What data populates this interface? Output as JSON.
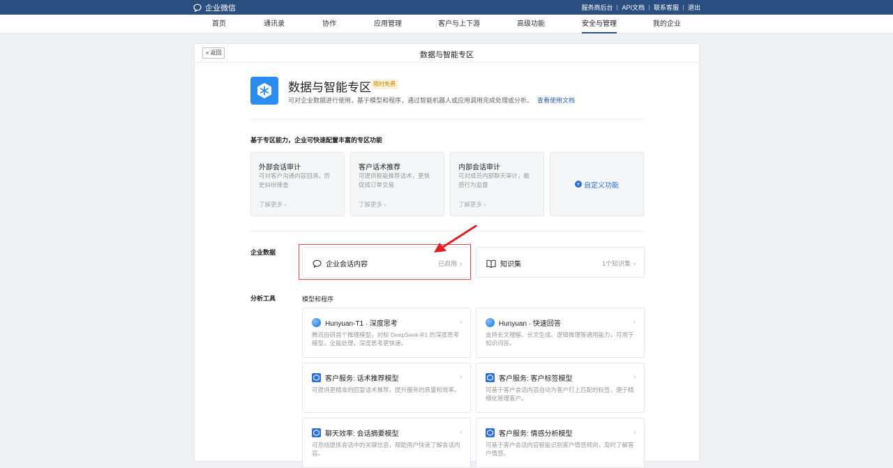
{
  "topbar": {
    "logo_text": "企业微信",
    "links": [
      "服务商后台",
      "API文档",
      "联系客服",
      "退出"
    ]
  },
  "nav": {
    "items": [
      "首页",
      "通讯录",
      "协作",
      "应用管理",
      "客户与上下游",
      "高级功能",
      "安全与管理",
      "我的企业"
    ],
    "active": "安全与管理"
  },
  "panel": {
    "back_label": "返回",
    "title": "数据与智能专区"
  },
  "hero": {
    "title": "数据与智能专区",
    "badge": "限时免费",
    "desc": "可对企业数据进行使用，基于模型和程序，通过智能机器人或应用调用完成处理或分析。",
    "link": "查看使用文档"
  },
  "features": {
    "title": "基于专区能力，企业可快速配置丰富的专区功能",
    "cards": [
      {
        "title": "外部会话审计",
        "desc": "可对客户沟通内容回溯，历史纠纷排查",
        "more": "了解更多 ›"
      },
      {
        "title": "客户话术推荐",
        "desc": "可提供智能推荐话术，更快促成订单交易",
        "more": "了解更多 ›"
      },
      {
        "title": "内部会话审计",
        "desc": "可对成员内部聊天审计，敏感行为监督",
        "more": "了解更多 ›"
      }
    ],
    "custom_label": "自定义功能"
  },
  "enterprise_data": {
    "label": "企业数据",
    "items": [
      {
        "title": "企业会话内容",
        "status": "已启用"
      },
      {
        "title": "知识集",
        "status": "1个知识集"
      }
    ]
  },
  "analysis": {
    "label": "分析工具",
    "sub_label": "模型和程序",
    "models": [
      {
        "icon": "hunyuan-icon",
        "title": "Hunyuan-T1 · 深度思考",
        "desc": "腾讯自研首个推理模型，对标 DeepSeek-R1 的深度思考模型，全能处理，深度思考更快速。"
      },
      {
        "icon": "hunyuan-icon",
        "title": "Hunyuan · 快速回答",
        "desc": "支持长文理解、长文生成、逻辑推理等通用能力，可用于知识问答。"
      },
      {
        "icon": "model-cube-icon",
        "title": "客户服务: 话术推荐模型",
        "desc": "可提供更精准的回复话术推荐，提升服务的质量和效率。"
      },
      {
        "icon": "model-cube-icon",
        "title": "客户服务: 客户标签模型",
        "desc": "可基于客户会话内容自动为客户打上匹配的标签，便于精细化管理客户。"
      },
      {
        "icon": "model-cube-icon",
        "title": "聊天效率: 会话摘要模型",
        "desc": "可总结提炼会话中的关键信息，帮助用户快速了解会话内容。"
      },
      {
        "icon": "model-cube-icon",
        "title": "客户服务: 情感分析模型",
        "desc": "可基于客户会话内容智能识别客户情感倾向，及时了解客户情感。"
      }
    ]
  },
  "colors": {
    "topbar": "#2a4e7f",
    "accent": "#2a6fcf",
    "annotation": "#e8474a"
  }
}
